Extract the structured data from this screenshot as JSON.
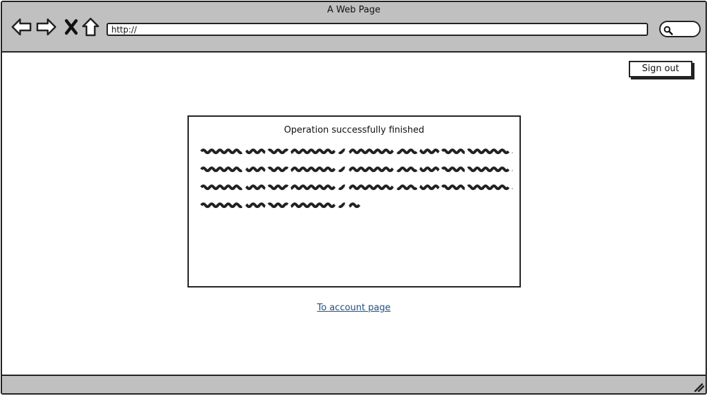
{
  "window": {
    "title": "A Web Page"
  },
  "toolbar": {
    "icons": [
      "back-arrow-icon",
      "forward-arrow-icon",
      "stop-icon",
      "home-icon",
      "search-icon"
    ],
    "url_value": "http://"
  },
  "header": {
    "signout_label": "Sign out"
  },
  "panel": {
    "title": "Operation successfully finished",
    "text_lines": 4,
    "placeholder_style": "scribbled-text"
  },
  "footer_link": {
    "label": "To account page"
  },
  "colors": {
    "chrome": "#c0c0c0",
    "border": "#222222",
    "link": "#1a4f8a"
  }
}
